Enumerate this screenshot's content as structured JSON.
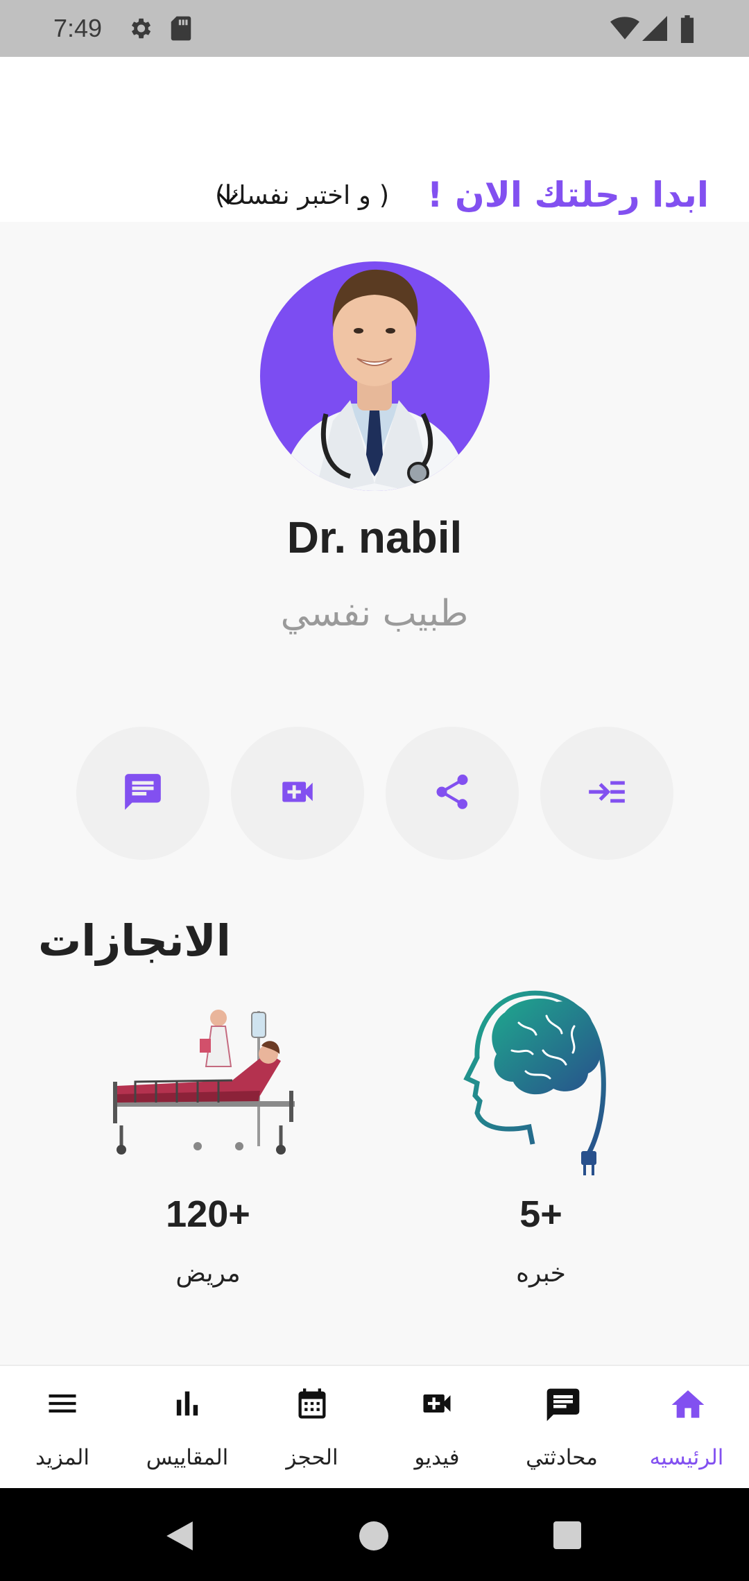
{
  "status_bar": {
    "time": "7:49",
    "icons": [
      "settings-icon",
      "sd-card-icon",
      "wifi-icon",
      "signal-icon",
      "battery-icon"
    ]
  },
  "header": {
    "headline": "ابدا رحلتك الان !",
    "subline": "( و اختبر نفسك)",
    "arrow_icon": "arrow-down-icon"
  },
  "profile": {
    "name": "Dr. nabil",
    "title": "طبيب نفسي"
  },
  "actions": [
    {
      "icon": "chat-icon"
    },
    {
      "icon": "video-add-icon"
    },
    {
      "icon": "share-icon"
    },
    {
      "icon": "enter-list-icon"
    }
  ],
  "achievements": {
    "title": "الانجازات",
    "items": [
      {
        "value": "120+",
        "label": "مريض",
        "icon": "patient-bed-illustration"
      },
      {
        "value": "5+",
        "label": "خبره",
        "icon": "brain-head-illustration"
      }
    ]
  },
  "bottom_nav": {
    "items": [
      {
        "label": "المزيد",
        "icon": "menu-icon",
        "active": false
      },
      {
        "label": "المقاييس",
        "icon": "bar-chart-icon",
        "active": false
      },
      {
        "label": "الحجز",
        "icon": "calendar-icon",
        "active": false
      },
      {
        "label": "فيديو",
        "icon": "video-icon",
        "active": false
      },
      {
        "label": "محادثتي",
        "icon": "chat-icon",
        "active": false
      },
      {
        "label": "الرئيسيه",
        "icon": "home-icon",
        "active": true
      }
    ]
  },
  "colors": {
    "accent": "#8250f0",
    "avatar_bg": "#7c4df2",
    "status_bar": "#c0c0c0",
    "background": "#f8f8f8"
  }
}
